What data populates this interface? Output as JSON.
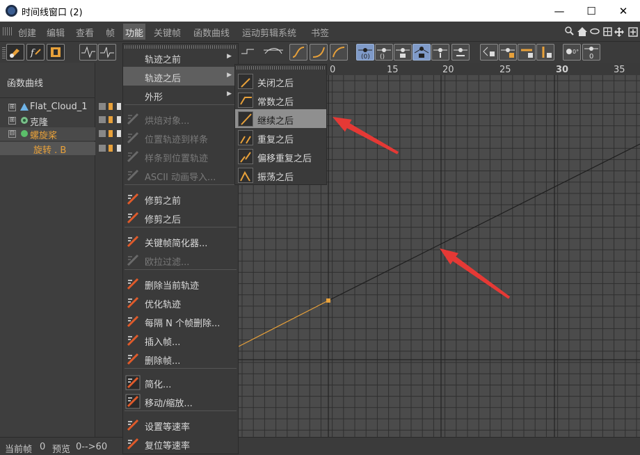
{
  "window": {
    "title": "时间线窗口 (2)",
    "minimize": "—",
    "maximize": "☐",
    "close": "✕"
  },
  "menubar": {
    "items": [
      "创建",
      "编辑",
      "查看",
      "帧",
      "功能",
      "关键帧",
      "函数曲线",
      "运动剪辑系统",
      "书签"
    ],
    "active": "功能"
  },
  "left_panel": {
    "title": "函数曲线",
    "tree": [
      {
        "label": "Flat_Cloud_1",
        "expander": "⊞",
        "color": "#d8d8d8",
        "icon_color": "#6fb4e8"
      },
      {
        "label": "克隆",
        "expander": "⊞",
        "color": "#d8d8d8",
        "icon_color": "#79c08a"
      },
      {
        "label": "螺旋桨",
        "expander": "⊟",
        "color": "#e8a13a",
        "icon_color": "#5bbf6a"
      },
      {
        "label": "旋转 . B",
        "expander": "",
        "color": "#e8a13a",
        "icon_color": ""
      }
    ]
  },
  "graph": {
    "ruler_labels": [
      "0",
      "15",
      "20",
      "25",
      "30",
      "35"
    ],
    "bold_label": "30",
    "grid_color": "#2f2f2f",
    "curve_color": "#1e1e1e",
    "selected_curve_color": "#e8a13a"
  },
  "status": {
    "current_frame_label": "当前帧",
    "current_frame_value": "0",
    "preview_label": "预览",
    "preview_value": "0-->60"
  },
  "dropdown": {
    "items": [
      {
        "label": "轨迹之前",
        "arrow": "▶",
        "disabled": false,
        "highlight": false,
        "icon": ""
      },
      {
        "label": "轨迹之后",
        "arrow": "▶",
        "disabled": false,
        "highlight": true,
        "icon": ""
      },
      {
        "label": "外形",
        "arrow": "▶",
        "disabled": false,
        "highlight": false,
        "icon": ""
      },
      {
        "label": "烘焙对象...",
        "arrow": "",
        "disabled": true,
        "highlight": false,
        "icon": "bake-icon"
      },
      {
        "label": "位置轨迹到样条",
        "arrow": "",
        "disabled": true,
        "highlight": false,
        "icon": "track-to-spline-icon"
      },
      {
        "label": "样条到位置轨迹",
        "arrow": "",
        "disabled": true,
        "highlight": false,
        "icon": "spline-to-track-icon"
      },
      {
        "label": "ASCII 动画导入...",
        "arrow": "",
        "disabled": true,
        "highlight": false,
        "icon": "ascii-import-icon"
      },
      {
        "label": "修剪之前",
        "arrow": "",
        "disabled": false,
        "highlight": false,
        "icon": "trim-before-icon"
      },
      {
        "label": "修剪之后",
        "arrow": "",
        "disabled": false,
        "highlight": false,
        "icon": "trim-after-icon"
      },
      {
        "label": "关键帧简化器...",
        "arrow": "",
        "disabled": false,
        "highlight": false,
        "icon": "key-reducer-icon"
      },
      {
        "label": "欧拉过滤...",
        "arrow": "",
        "disabled": true,
        "highlight": false,
        "icon": "euler-filter-icon"
      },
      {
        "label": "删除当前轨迹",
        "arrow": "",
        "disabled": false,
        "highlight": false,
        "icon": "delete-track-icon"
      },
      {
        "label": "优化轨迹",
        "arrow": "",
        "disabled": false,
        "highlight": false,
        "icon": "optimize-track-icon"
      },
      {
        "label": "每隔 N 个帧删除...",
        "arrow": "",
        "disabled": false,
        "highlight": false,
        "icon": "delete-every-n-icon"
      },
      {
        "label": "插入帧...",
        "arrow": "",
        "disabled": false,
        "highlight": false,
        "icon": "insert-frame-icon"
      },
      {
        "label": "删除帧...",
        "arrow": "",
        "disabled": false,
        "highlight": false,
        "icon": "delete-frame-icon"
      },
      {
        "label": "简化...",
        "arrow": "",
        "disabled": false,
        "highlight": false,
        "icon": "simplify-icon"
      },
      {
        "label": "移动/缩放...",
        "arrow": "",
        "disabled": false,
        "highlight": false,
        "icon": "move-scale-icon"
      },
      {
        "label": "设置等速率",
        "arrow": "",
        "disabled": false,
        "highlight": false,
        "icon": "set-linear-speed-icon"
      },
      {
        "label": "复位等速率",
        "arrow": "",
        "disabled": false,
        "highlight": false,
        "icon": "reset-linear-speed-icon"
      }
    ]
  },
  "submenu": {
    "items": [
      {
        "label": "关闭之后",
        "highlight": false
      },
      {
        "label": "常数之后",
        "highlight": false
      },
      {
        "label": "继续之后",
        "highlight": true
      },
      {
        "label": "重复之后",
        "highlight": false
      },
      {
        "label": "偏移重复之后",
        "highlight": false
      },
      {
        "label": "振荡之后",
        "highlight": false
      }
    ]
  },
  "annotation_color": "#e53935"
}
